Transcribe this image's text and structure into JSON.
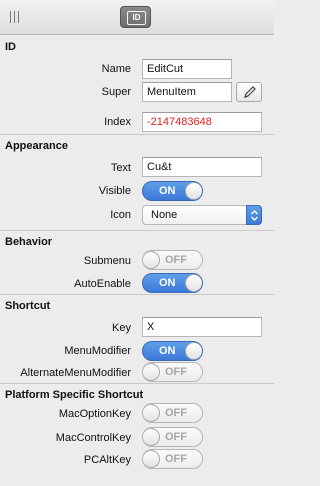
{
  "toolbar": {
    "grip_icon": "grip-handle-icon",
    "id_tab_label": "ID"
  },
  "sections": {
    "id": {
      "title": "ID",
      "name_label": "Name",
      "name_value": "EditCut",
      "super_label": "Super",
      "super_value": "MenuItem",
      "edit_icon": "pencil-icon",
      "index_label": "Index",
      "index_value": "-2147483648"
    },
    "appearance": {
      "title": "Appearance",
      "text_label": "Text",
      "text_value": "Cu&t",
      "visible_label": "Visible",
      "visible_state": "ON",
      "icon_label": "Icon",
      "icon_value": "None"
    },
    "behavior": {
      "title": "Behavior",
      "submenu_label": "Submenu",
      "submenu_state": "OFF",
      "autoenable_label": "AutoEnable",
      "autoenable_state": "ON"
    },
    "shortcut": {
      "title": "Shortcut",
      "key_label": "Key",
      "key_value": "X",
      "menumodifier_label": "MenuModifier",
      "menumodifier_state": "ON",
      "altmenumodifier_label": "AlternateMenuModifier",
      "altmenumodifier_state": "OFF"
    },
    "platform": {
      "title": "Platform Specific Shortcut",
      "macoption_label": "MacOptionKey",
      "macoption_state": "OFF",
      "maccontrol_label": "MacControlKey",
      "maccontrol_state": "OFF",
      "pcalt_label": "PCAltKey",
      "pcalt_state": "OFF"
    }
  },
  "colors": {
    "toggle_on": "#3c78d8",
    "index_text": "#e02020"
  }
}
